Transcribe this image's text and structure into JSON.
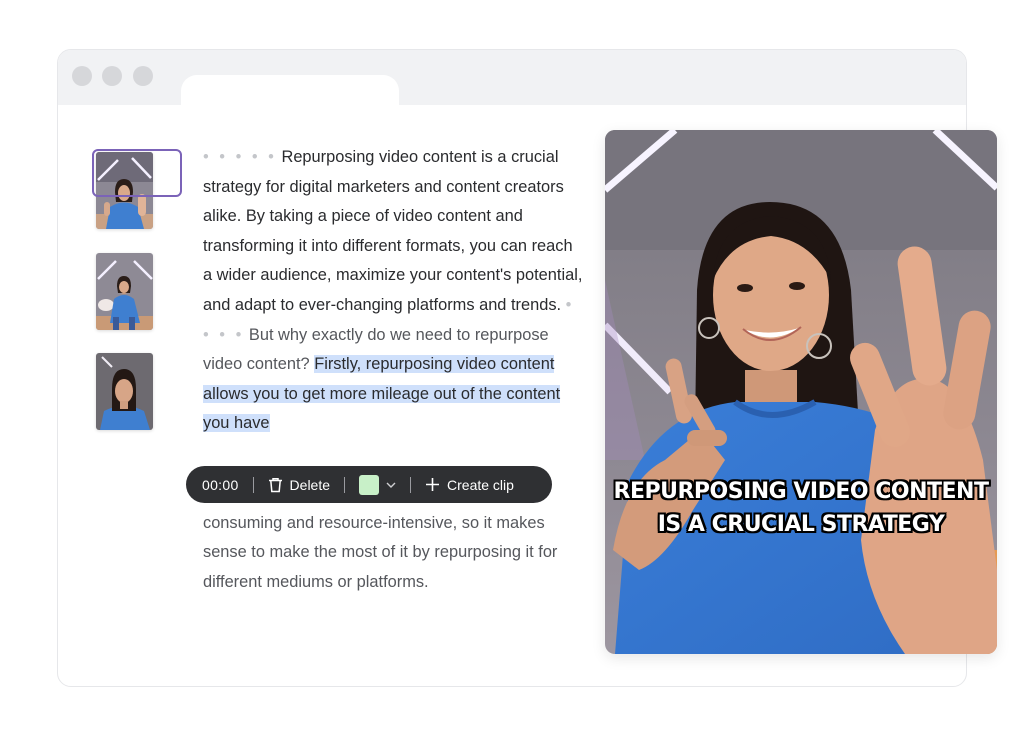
{
  "transcript": {
    "pause_marks_1": "• • • • •",
    "para1": "Repurposing video content is a crucial strategy for digital marketers and content creators alike. By taking a piece of video content and transforming it into different formats, you can reach a wider audience, maximize your content's potential, and adapt to ever-changing platforms and trends.",
    "pause_marks_2": "• • • •",
    "para2_start": "But why exactly do we need to repurpose video content?",
    "highlight": "Firstly, repurposing video content allows you to get more mileage out of the content you have",
    "para2_rest": "single piece of video content can be time-consuming and resource-intensive, so it makes sense to make the most of it by repurposing it for different mediums or platforms."
  },
  "toolbar": {
    "timestamp": "00:00",
    "delete_label": "Delete",
    "swatch_color": "#c8f0c8",
    "create_clip_label": "Create clip"
  },
  "preview": {
    "caption_line1": "REPURPOSING VIDEO CONTENT",
    "caption_line2": "IS A CRUCIAL STRATEGY"
  },
  "colors": {
    "accent_purple": "#7b63b8",
    "highlight_blue": "#cfe0fb",
    "toolbar_bg": "#2f3033"
  }
}
